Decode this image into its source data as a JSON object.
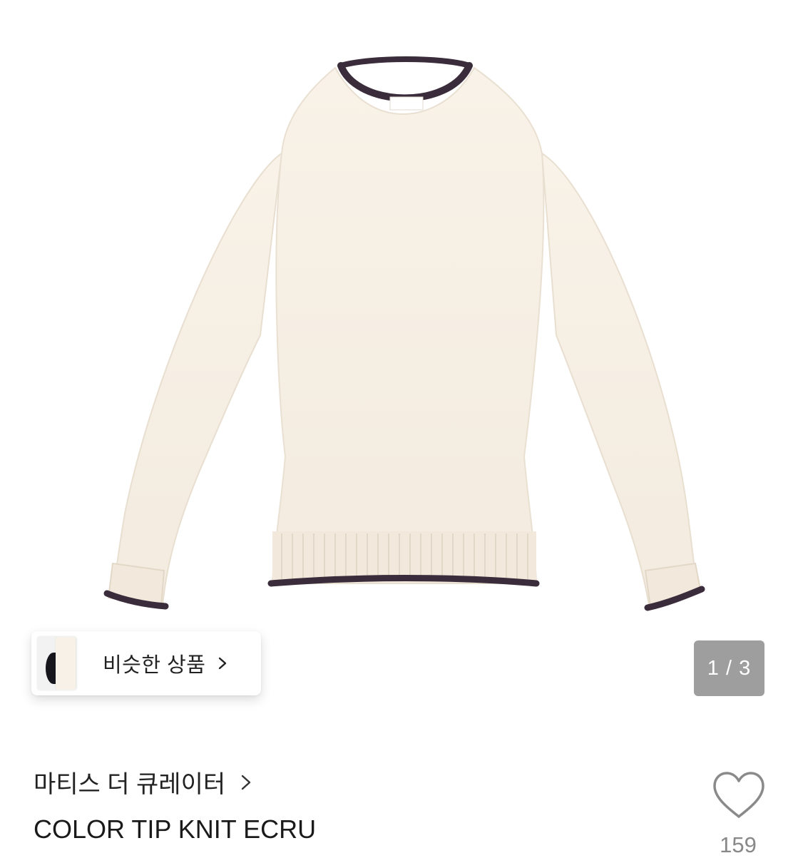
{
  "product_image": {
    "sweater_color": "#f6efe4",
    "trim_color": "#3a2c3a"
  },
  "similar_products": {
    "label": "비슷한 상품",
    "chevron_icon": "chevron-right-icon"
  },
  "gallery": {
    "counter": "1 / 3"
  },
  "product": {
    "brand": "마티스 더 큐레이터",
    "name": "COLOR TIP KNIT ECRU"
  },
  "like": {
    "icon": "heart-outline-icon",
    "count": "159"
  }
}
